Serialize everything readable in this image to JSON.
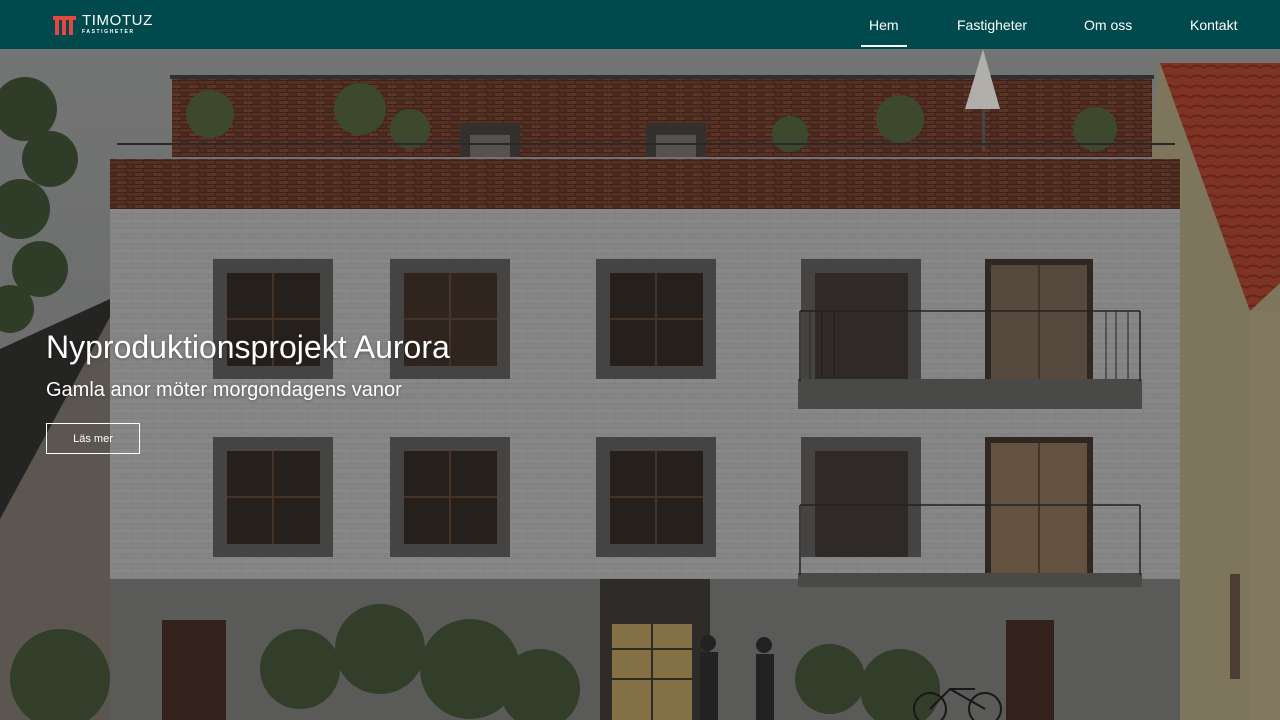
{
  "header": {
    "logo": {
      "name": "TIMOTUZ",
      "tagline": "FASTIGHETER",
      "icon": "timotuz-logo-icon"
    },
    "nav": [
      {
        "label": "Hem",
        "active": true
      },
      {
        "label": "Fastigheter",
        "active": false
      },
      {
        "label": "Om oss",
        "active": false
      },
      {
        "label": "Kontakt",
        "active": false
      }
    ]
  },
  "hero": {
    "title": "Nyproduktionsprojekt Aurora",
    "subtitle": "Gamla anor möter morgondagens vanor",
    "button_label": "Läs mer",
    "image": "apartment-building-rendering"
  },
  "colors": {
    "header_bg": "#004a4e",
    "logo_accent": "#e7453f",
    "text": "#ffffff"
  }
}
